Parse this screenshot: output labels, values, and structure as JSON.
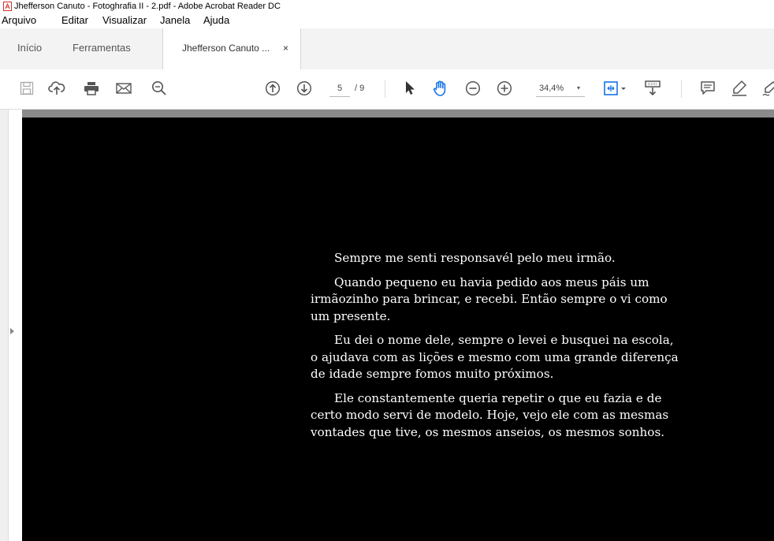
{
  "window": {
    "title": "Jhefferson Canuto - Fotoghrafia II - 2.pdf - Adobe Acrobat Reader DC"
  },
  "menu": [
    "Arquivo",
    "Editar",
    "Visualizar",
    "Janela",
    "Ajuda"
  ],
  "tabs": {
    "home": "Início",
    "tools": "Ferramentas",
    "document": "Jhefferson Canuto ...",
    "close": "×"
  },
  "toolbar": {
    "icons": [
      "save-icon",
      "upload-icon",
      "print-icon",
      "email-icon",
      "zoom-search-icon",
      "page-up-icon",
      "page-down-icon",
      "select-cursor-icon",
      "hand-tool-icon",
      "zoom-out-icon",
      "zoom-in-icon",
      "fit-page-icon",
      "scroll-mode-icon",
      "comment-icon",
      "highlight-icon",
      "sign-icon"
    ],
    "current_page": "5",
    "page_total": "/ 9",
    "zoom": "34,4%",
    "zoom_caret": "▾"
  },
  "document": {
    "background": "#000000",
    "paragraphs": [
      "Sempre me senti responsavél pelo meu irmão.",
      "Quando pequeno eu havia pedido aos meus páis um irmãozinho para brincar, e recebi. Então sempre o vi como um presente.",
      "Eu dei o nome dele, sempre o levei e busquei na escola, o ajudava com as lições e mesmo com uma grande diferença de idade sempre fomos muito próximos.",
      "Ele constantemente queria repetir o que eu fazia e de certo modo servi de modelo. Hoje, vejo ele com as mesmas vontades que tive, os mesmos anseios, os mesmos sonhos."
    ]
  },
  "colors": {
    "accent": "#1473e6",
    "pdf_red": "#d4302a"
  }
}
